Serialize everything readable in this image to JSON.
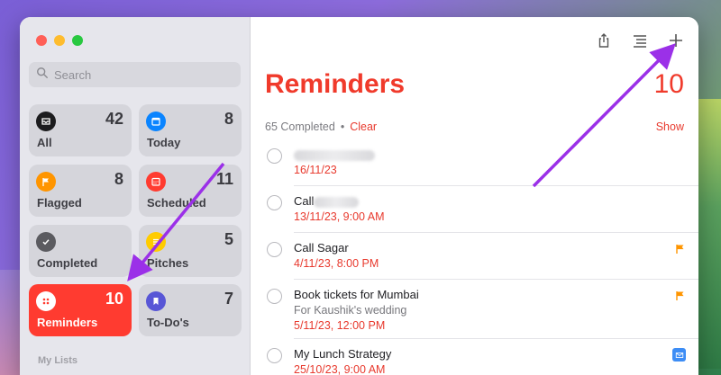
{
  "sidebar": {
    "search_placeholder": "Search",
    "tiles": [
      {
        "label": "All",
        "count": "42",
        "icon": "tray-icon",
        "color": "#1c1c1e"
      },
      {
        "label": "Today",
        "count": "8",
        "icon": "calendar-today-icon",
        "color": "#0a84ff"
      },
      {
        "label": "Flagged",
        "count": "8",
        "icon": "flag-icon",
        "color": "#ff9500"
      },
      {
        "label": "Scheduled",
        "count": "11",
        "icon": "calendar-icon",
        "color": "#ff3b30"
      },
      {
        "label": "Completed",
        "count": "",
        "icon": "checkmark-icon",
        "color": "#5b5b60"
      },
      {
        "label": "Pitches",
        "count": "5",
        "icon": "list-icon",
        "color": "#ffcc00"
      },
      {
        "label": "Reminders",
        "count": "10",
        "icon": "list-icon",
        "color": "#ff3b30",
        "active": true
      },
      {
        "label": "To-Do's",
        "count": "7",
        "icon": "bookmark-icon",
        "color": "#5856d6"
      }
    ],
    "section_label": "My Lists"
  },
  "main": {
    "title": "Reminders",
    "count": "10",
    "completed_text": "65 Completed",
    "clear_label": "Clear",
    "show_label": "Show",
    "items": [
      {
        "name": "",
        "note": "",
        "date": "16/11/23",
        "blurred": true
      },
      {
        "name": "Call",
        "note": "",
        "date": "13/11/23, 9:00 AM",
        "blurred_suffix": true
      },
      {
        "name": "Call Sagar",
        "note": "",
        "date": "4/11/23, 8:00 PM",
        "flag": true
      },
      {
        "name": "Book tickets for Mumbai",
        "note": "For Kaushik's wedding",
        "date": "5/11/23, 12:00 PM",
        "flag": true
      },
      {
        "name": "My Lunch Strategy",
        "note": "",
        "date": "25/10/23, 9:00 AM",
        "mail": true
      }
    ]
  },
  "colors": {
    "accent": "#f03a2b",
    "annotation_arrow": "#9b30e8"
  }
}
